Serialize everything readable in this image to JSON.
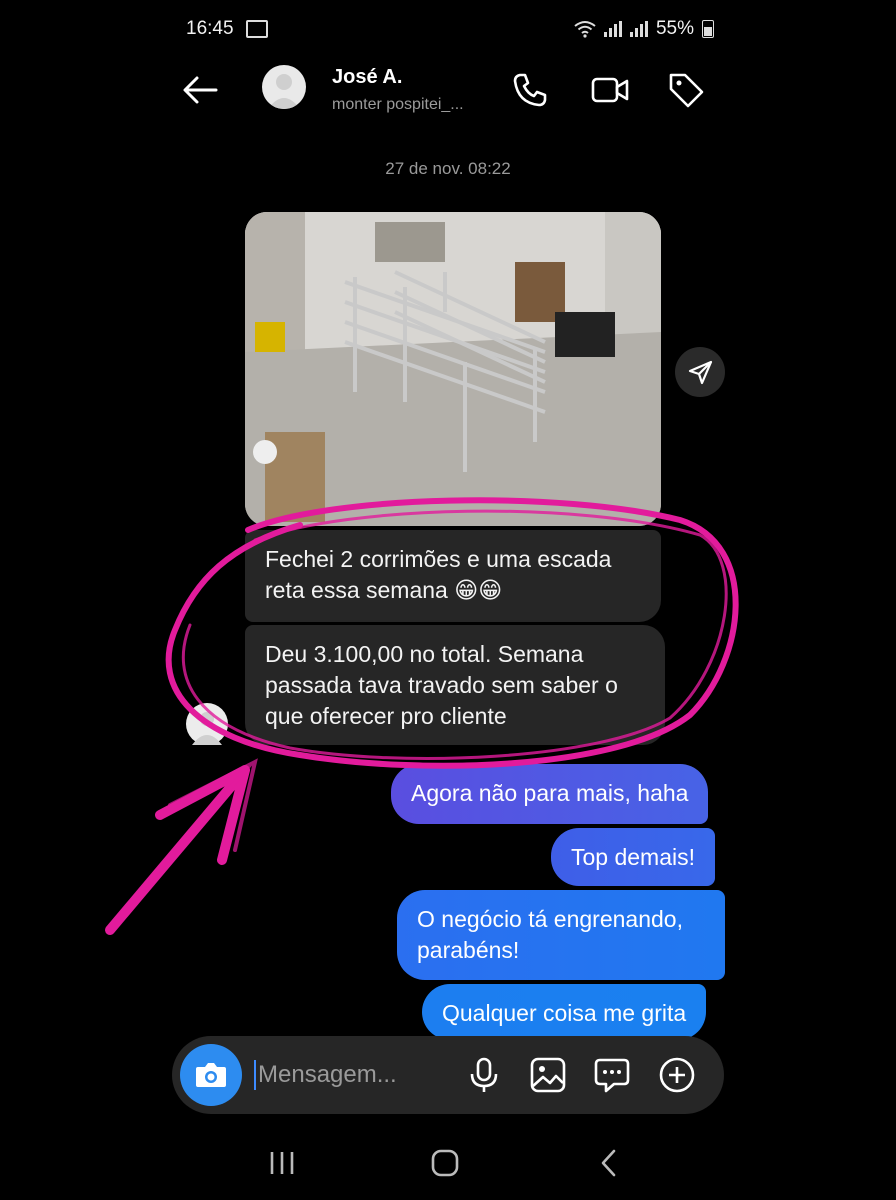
{
  "status_bar": {
    "time": "16:45",
    "battery": "55%",
    "icons": [
      "cast-icon",
      "wifi-icon",
      "signal-icon",
      "signal-icon",
      "battery-icon"
    ]
  },
  "header": {
    "contact_name": "José A.",
    "subtitle": "monter pospitei_...",
    "icons": [
      "back-arrow-icon",
      "phone-icon",
      "video-call-icon",
      "tag-icon"
    ]
  },
  "conversation": {
    "date_label": "27 de nov. 08:22",
    "incoming": [
      {
        "type": "image",
        "description_icon": "photo-attachment"
      },
      {
        "type": "text",
        "text": "Fechei 2 corrimões e uma escada reta essa semana 😁😁"
      },
      {
        "type": "text",
        "text": "Deu 3.100,00 no total. Semana passada tava travado sem saber o que oferecer pro cliente"
      }
    ],
    "outgoing": [
      {
        "text": "Agora não para mais, haha"
      },
      {
        "text": "Top demais!"
      },
      {
        "text": "O negócio tá engrenando, parabéns!"
      },
      {
        "text": "Qualquer coisa me grita"
      }
    ]
  },
  "composer": {
    "placeholder": "Mensagem...",
    "value": "",
    "icons": [
      "camera-icon",
      "microphone-icon",
      "gallery-icon",
      "sticker-icon",
      "plus-icon"
    ]
  },
  "nav_bar": {
    "icons": [
      "recents-icon",
      "home-icon",
      "back-icon"
    ]
  },
  "colors": {
    "background": "#000000",
    "incoming_bubble": "#262626",
    "outgoing_gradient_start": "#4b4fe0",
    "outgoing_gradient_end": "#1c7ef0",
    "annotation": "#e21b9c",
    "camera_button": "#2d8cf0"
  }
}
